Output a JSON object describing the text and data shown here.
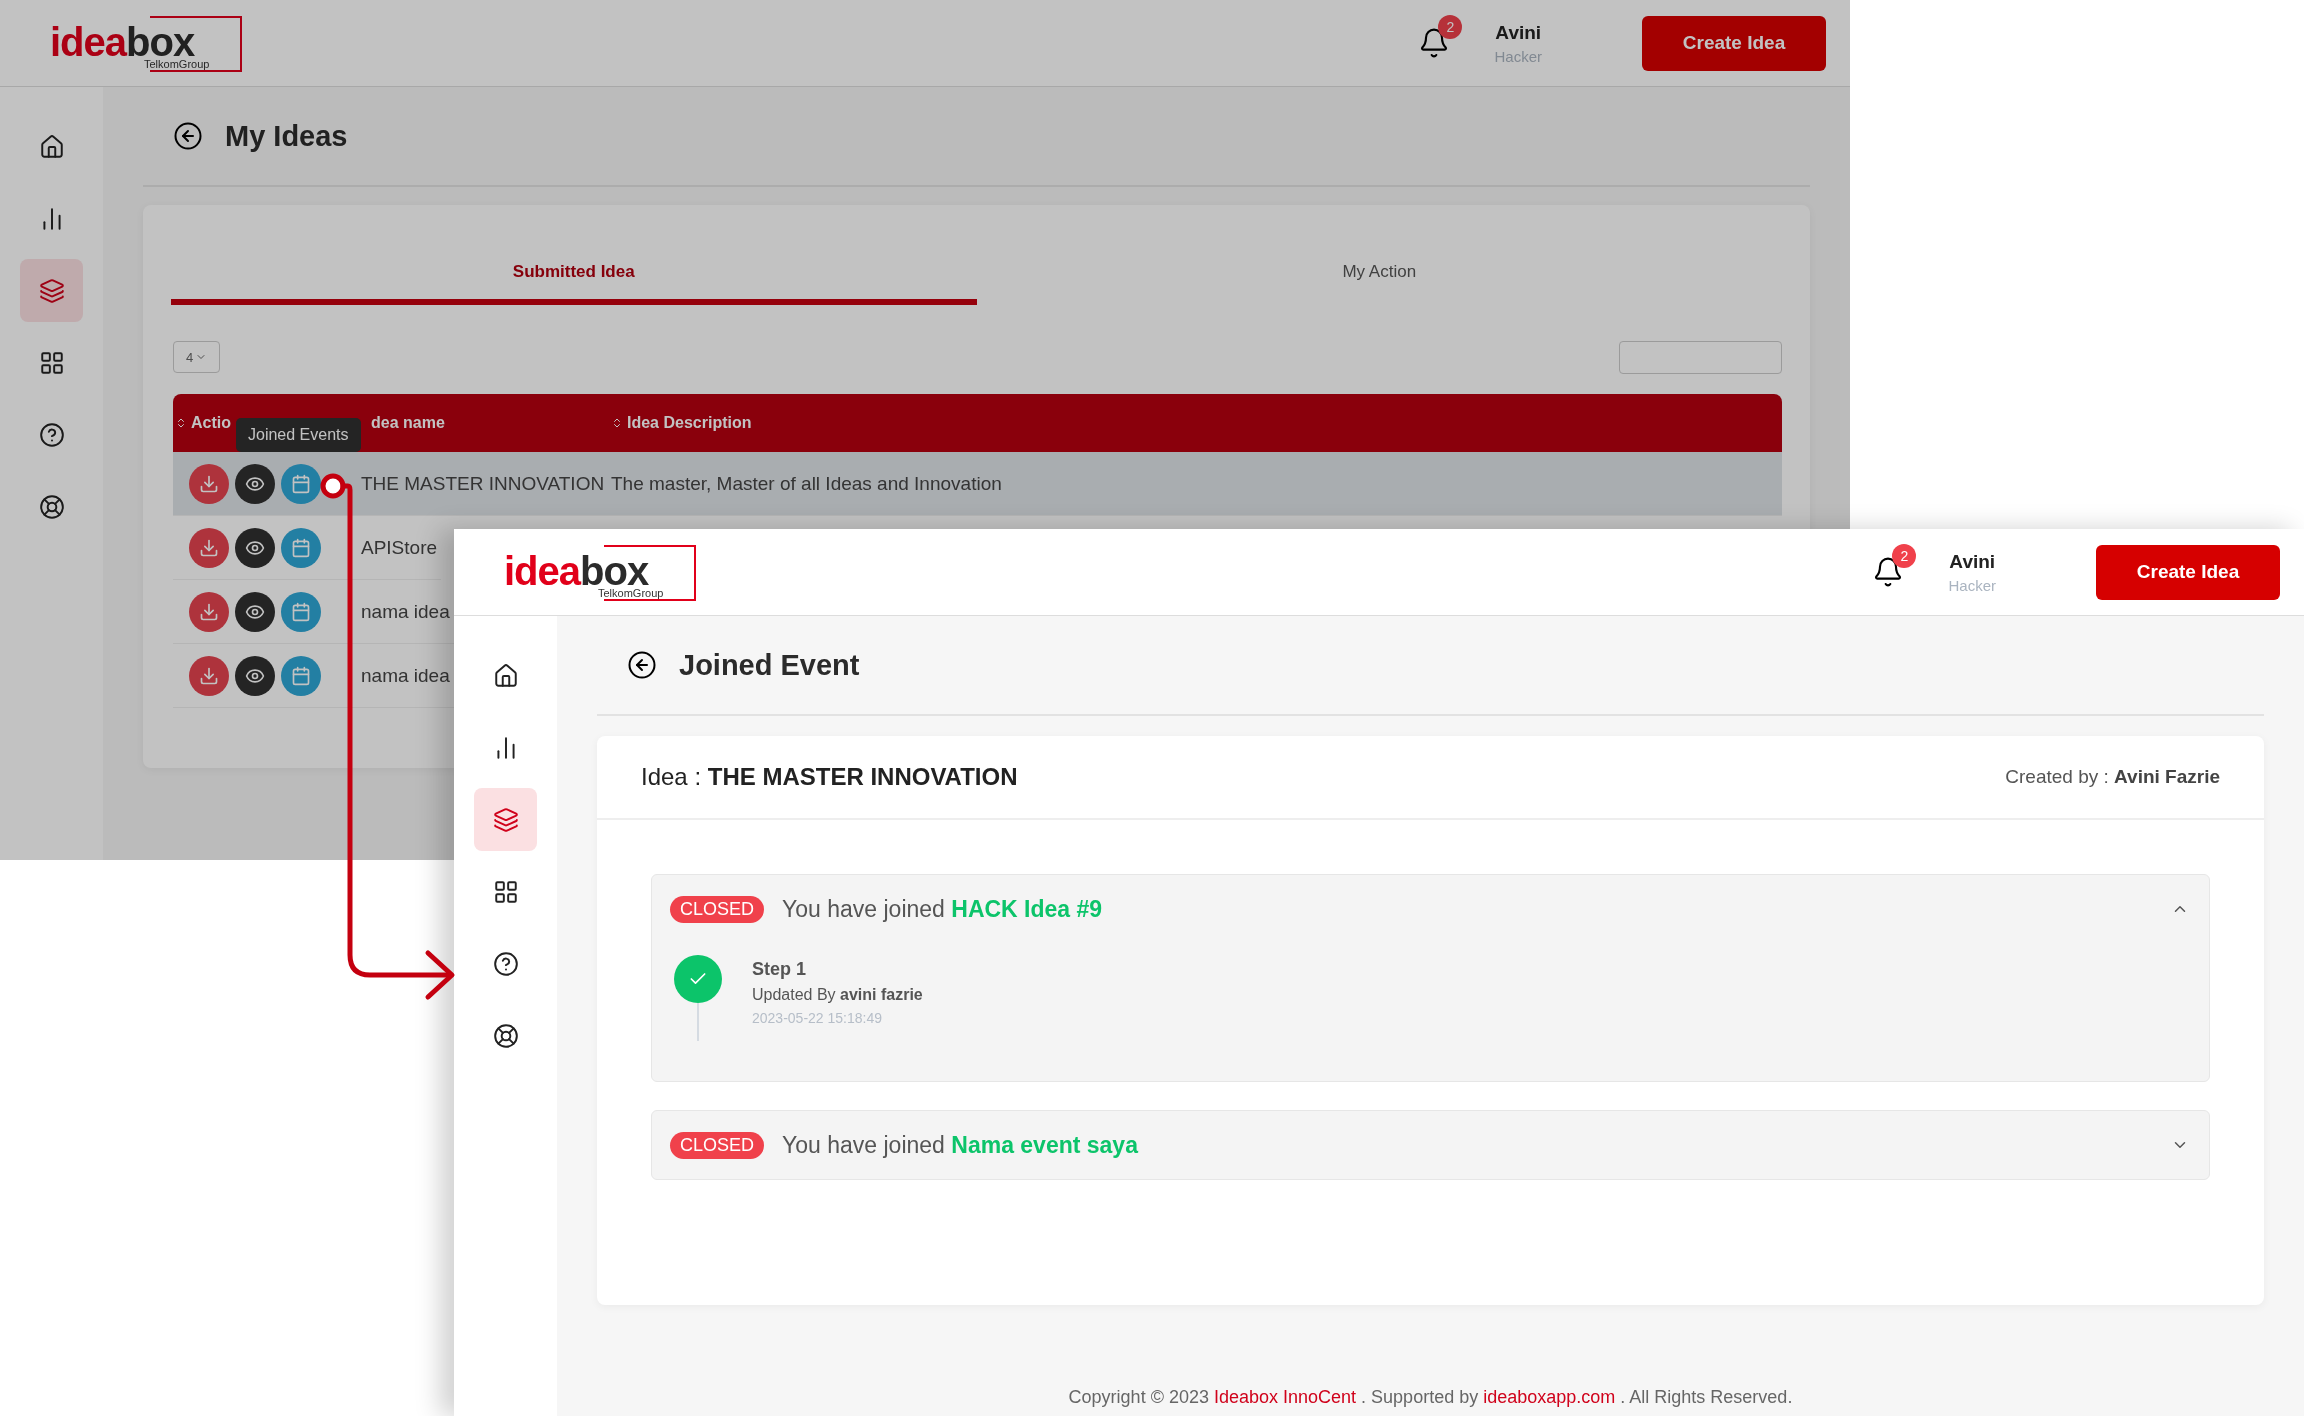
{
  "back_screen": {
    "header": {
      "logo": {
        "part_1": "idea",
        "part_2": "box",
        "tagline": "TelkomGroup"
      },
      "notification_count": "2",
      "user_name": "Avini",
      "user_role": "Hacker",
      "create_button": "Create Idea"
    },
    "sidebar": {
      "items": [
        {
          "selected": false
        },
        {
          "selected": false
        },
        {
          "selected": true
        },
        {
          "selected": false
        },
        {
          "selected": false
        },
        {
          "selected": false
        }
      ]
    },
    "page_title": "My Ideas",
    "tabs": [
      {
        "label": "Submitted Idea",
        "selected": true
      },
      {
        "label": "My Action",
        "selected": false
      }
    ],
    "page_size": "4",
    "table": {
      "columns": [
        {
          "label": "Actio",
          "sortable": true
        },
        {
          "label": "dea name",
          "sortable": false
        },
        {
          "label": "Idea Description",
          "sortable": true
        }
      ],
      "tooltip": "Joined Events",
      "rows": [
        {
          "name": "THE MASTER INNOVATION",
          "description": "The master, Master of all Ideas and Innovation",
          "selected": true
        },
        {
          "name": "APIStore",
          "selected": false
        },
        {
          "name": "nama idea",
          "selected": false
        },
        {
          "name": "nama idea",
          "selected": false
        }
      ]
    }
  },
  "front_screen": {
    "header": {
      "logo": {
        "part_1": "idea",
        "part_2": "box",
        "tagline": "TelkomGroup"
      },
      "notification_count": "2",
      "user_name": "Avini",
      "user_role": "Hacker",
      "create_button": "Create Idea"
    },
    "sidebar": {
      "items": [
        {
          "selected": false
        },
        {
          "selected": false
        },
        {
          "selected": true
        },
        {
          "selected": false
        },
        {
          "selected": false
        },
        {
          "selected": false
        }
      ]
    },
    "page_title": "Joined Event",
    "idea_label": "Idea :",
    "idea_name": "THE MASTER INNOVATION",
    "created_by_label": "Created by :",
    "created_by": "Avini Fazrie",
    "events": [
      {
        "status": "CLOSED",
        "text": "You have joined",
        "event": "HACK Idea #9",
        "expanded": true,
        "steps": [
          {
            "title": "Step 1",
            "updated_label": "Updated By",
            "updated_by": "avini fazrie",
            "time": "2023-05-22 15:18:49",
            "done": true
          }
        ]
      },
      {
        "status": "CLOSED",
        "text": "You have joined",
        "event": "Nama event saya",
        "expanded": false
      }
    ],
    "footer": {
      "prefix": "Copyright © 2023",
      "link_1": "Ideabox InnoCent",
      "middle": ". Supported by",
      "link_2": "ideaboxapp.com",
      "suffix": ". All Rights Reserved."
    }
  }
}
